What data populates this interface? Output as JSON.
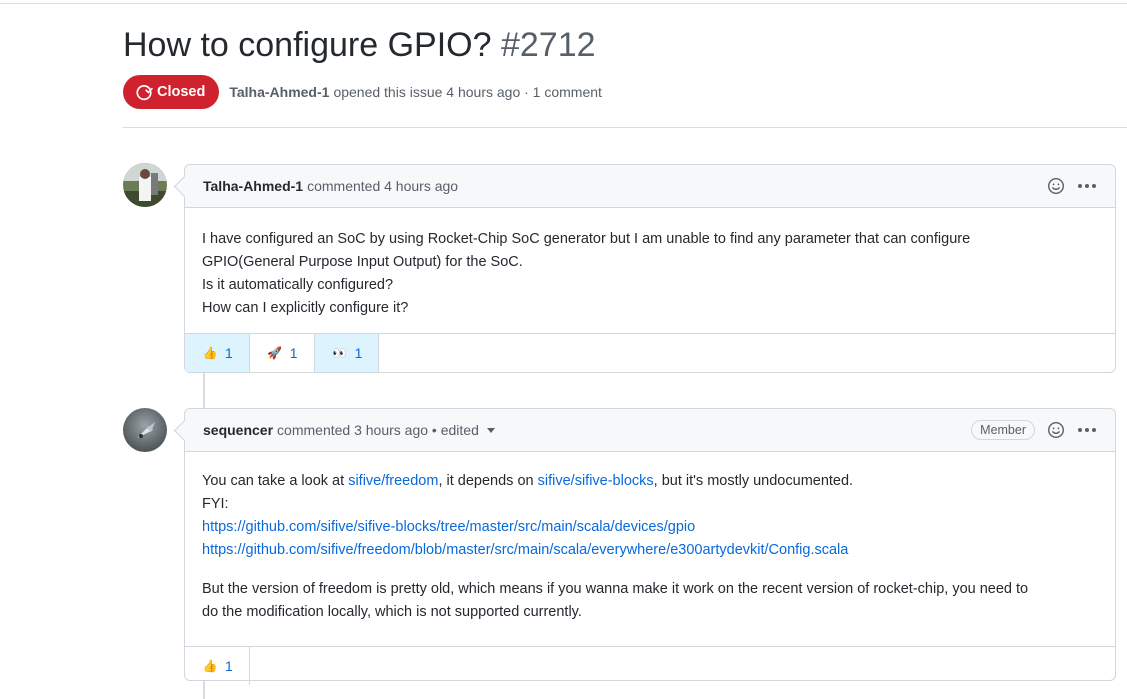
{
  "issue": {
    "title": "How to configure GPIO?",
    "number": "#2712",
    "state": "Closed",
    "author": "Talha-Ahmed-1",
    "opened_text": "opened this issue 4 hours ago · 1 comment"
  },
  "comments": [
    {
      "author": "Talha-Ahmed-1",
      "action": "commented 4 hours ago",
      "body_lines": [
        "I have configured an SoC by using Rocket-Chip SoC generator but I am unable to find any parameter that can configure",
        "GPIO(General Purpose Input Output) for the SoC.",
        "Is it automatically configured?",
        "How can I explicitly configure it?"
      ],
      "reactions": [
        {
          "emoji": "👍",
          "count": "1"
        },
        {
          "emoji": "🚀",
          "count": "1"
        },
        {
          "emoji": "👀",
          "count": "1"
        }
      ]
    },
    {
      "author": "sequencer",
      "action": "commented 3 hours ago • edited",
      "badge": "Member",
      "body": {
        "p1_a": "You can take a look at ",
        "link1": "sifive/freedom",
        "p1_b": ", it depends on ",
        "link2": "sifive/sifive-blocks",
        "p1_c": ", but it's mostly undocumented.",
        "fyi": "FYI:",
        "url1": "https://github.com/sifive/sifive-blocks/tree/master/src/main/scala/devices/gpio",
        "url2": "https://github.com/sifive/freedom/blob/master/src/main/scala/everywhere/e300artydevkit/Config.scala",
        "p2_line1": "But the version of freedom is pretty old, which means if you wanna make it work on the recent version of rocket-chip, you need to",
        "p2_line2": "do the modification locally, which is not supported currently."
      },
      "reactions": [
        {
          "emoji": "👍",
          "count": "1"
        }
      ]
    }
  ],
  "colors": {
    "closed_red": "#cf222e",
    "link_blue": "#0969da",
    "reaction_selected_bg": "#ddf4ff"
  },
  "icons": {
    "state": "issue-closed-icon",
    "smiley": "smiley-icon",
    "kebab": "kebab-horizontal-icon"
  }
}
